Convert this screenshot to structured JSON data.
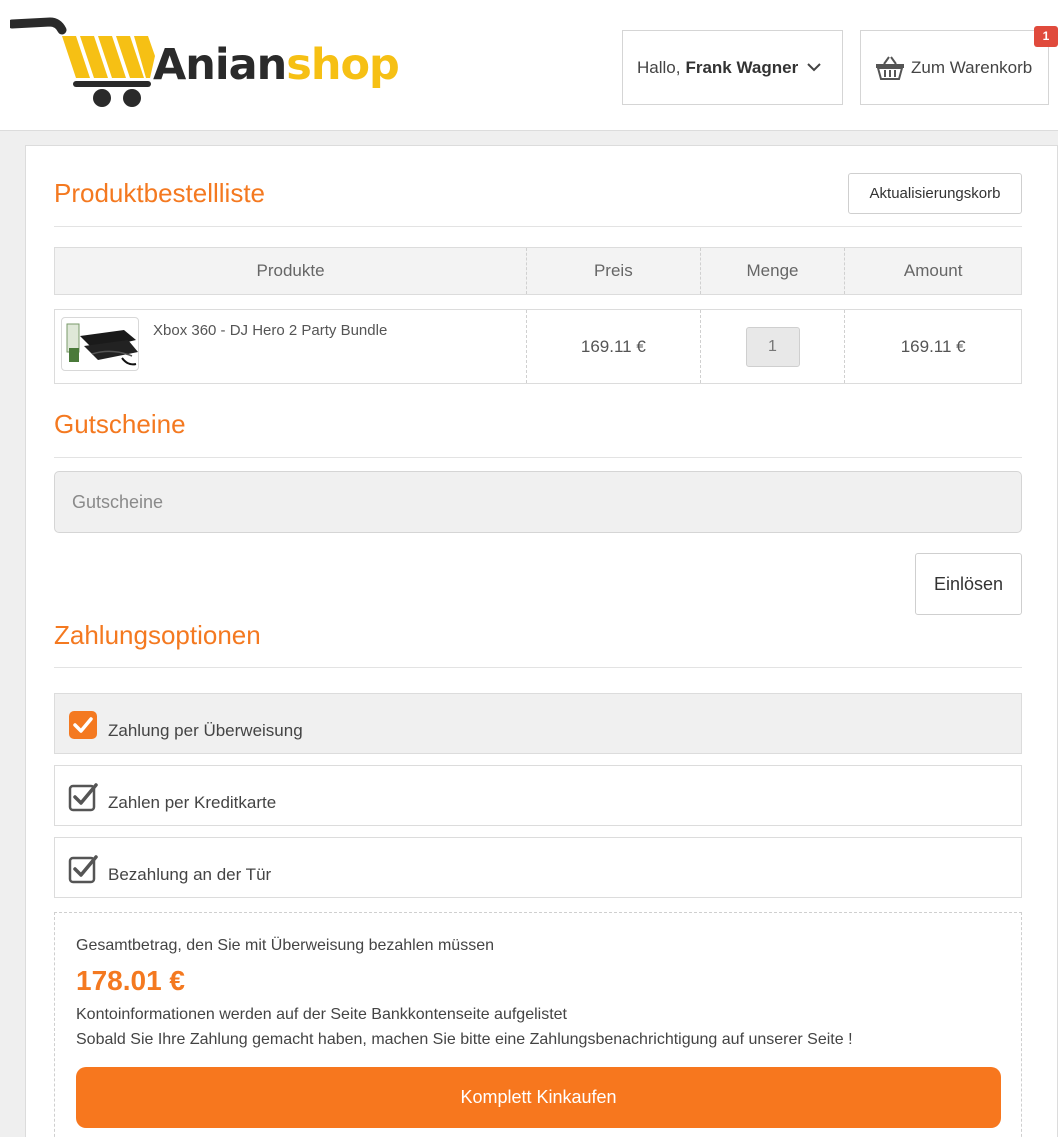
{
  "brand": {
    "part1": "Anian",
    "part2": "shop"
  },
  "header": {
    "greeting": "Hallo,",
    "user_name": "Frank Wagner",
    "cart_label": "Zum Warenkorb",
    "cart_count": "1"
  },
  "order": {
    "title": "Produktbestellliste",
    "refresh_label": "Aktualisierungskorb",
    "columns": [
      "Produkte",
      "Preis",
      "Menge",
      "Amount"
    ],
    "items": [
      {
        "name": "Xbox 360 - DJ Hero 2 Party Bundle",
        "price": "169.11 €",
        "qty": "1",
        "amount": "169.11 €"
      }
    ]
  },
  "vouchers": {
    "title": "Gutscheine",
    "placeholder": "Gutscheine",
    "redeem_label": "Einlösen"
  },
  "payment": {
    "title": "Zahlungsoptionen",
    "options": [
      {
        "label": "Zahlung per Überweisung",
        "selected": true
      },
      {
        "label": "Zahlen per Kreditkarte",
        "selected": false
      },
      {
        "label": "Bezahlung an der Tür",
        "selected": false
      }
    ]
  },
  "summary": {
    "intro": "Gesamtbetrag, den Sie mit Überweisung bezahlen müssen",
    "total": "178.01 €",
    "note1": "Kontoinformationen werden auf der Seite Bankkontenseite aufgelistet",
    "note2": "Sobald Sie Ihre Zahlung gemacht haben, machen Sie bitte eine Zahlungsbenachrichtigung auf unserer Seite !",
    "button_label": "Komplett Kinkaufen"
  },
  "colors": {
    "accent": "#f47920",
    "button": "#f7771e",
    "logo_yellow": "#f6c014",
    "badge": "#e04a3c"
  }
}
